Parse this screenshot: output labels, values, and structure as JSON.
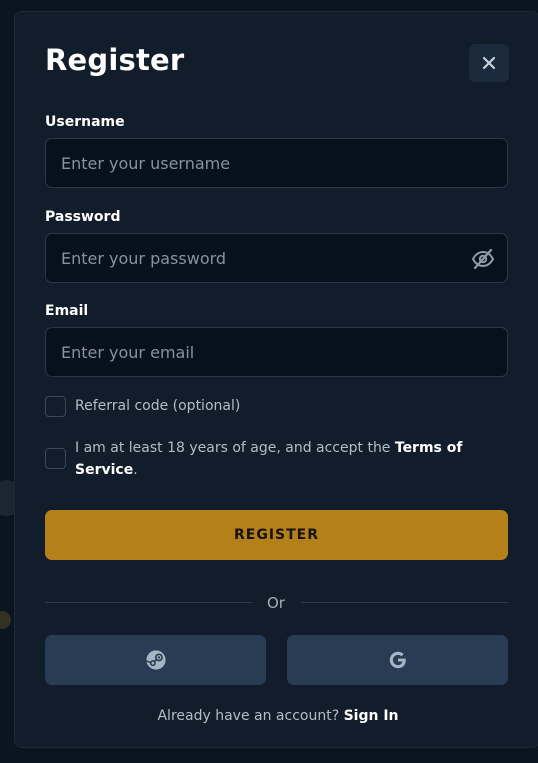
{
  "modal": {
    "title": "Register",
    "close_icon": "close-icon"
  },
  "username": {
    "label": "Username",
    "placeholder": "Enter your username",
    "value": ""
  },
  "password": {
    "label": "Password",
    "placeholder": "Enter your password",
    "value": "",
    "toggle_icon": "eye-off-icon"
  },
  "email": {
    "label": "Email",
    "placeholder": "Enter your email",
    "value": ""
  },
  "referral": {
    "label": "Referral code (optional)",
    "checked": false
  },
  "terms": {
    "text_before": "I am at least 18 years of age, and accept the ",
    "link": "Terms of Service",
    "text_after": ".",
    "checked": false
  },
  "register_button": "REGISTER",
  "divider_text": "Or",
  "social": {
    "steam_icon": "steam-icon",
    "google_icon": "google-icon"
  },
  "footer": {
    "prompt": "Already have an account? ",
    "link": "Sign In"
  },
  "colors": {
    "modal_bg": "#111d2b",
    "input_bg": "#06111d",
    "accent": "#b48019",
    "social_bg": "#2a3c54"
  }
}
